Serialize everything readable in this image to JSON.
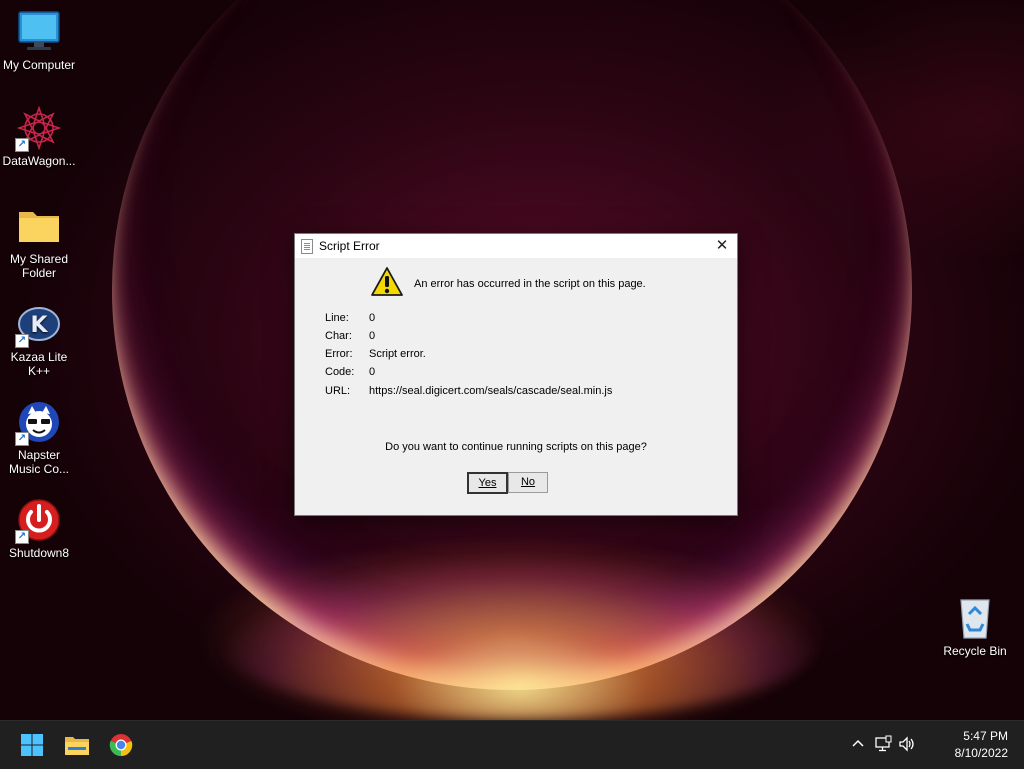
{
  "desktop": {
    "icons": [
      {
        "label": "My Computer"
      },
      {
        "label": "DataWagon..."
      },
      {
        "label_line1": "My Shared",
        "label_line2": "Folder"
      },
      {
        "label_line1": "Kazaa Lite",
        "label_line2": "K++"
      },
      {
        "label_line1": "Napster",
        "label_line2": "Music Co..."
      },
      {
        "label": "Shutdown8"
      },
      {
        "label": "Recycle Bin"
      }
    ]
  },
  "dialog": {
    "title": "Script Error",
    "close_glyph": "✕",
    "message": "An error has occurred in the script on this page.",
    "details": {
      "line_label": "Line:",
      "line_value": "0",
      "char_label": "Char:",
      "char_value": "0",
      "error_label": "Error:",
      "error_value": "Script error.",
      "code_label": "Code:",
      "code_value": "0",
      "url_label": "URL:",
      "url_value": "https://seal.digicert.com/seals/cascade/seal.min.js"
    },
    "question": "Do you want to continue running scripts on this page?",
    "yes_label": "Yes",
    "no_label": "No"
  },
  "taskbar": {
    "pinned": [
      "start-icon",
      "file-explorer-icon",
      "chrome-icon"
    ],
    "tray_icons": [
      "chevron-up-icon",
      "network-icon",
      "volume-icon"
    ],
    "time": "5:47 PM",
    "date": "8/10/2022"
  },
  "colors": {
    "taskbar_bg": "#202020",
    "dialog_bg": "#f0f0f0",
    "warning_yellow": "#f5d800"
  }
}
